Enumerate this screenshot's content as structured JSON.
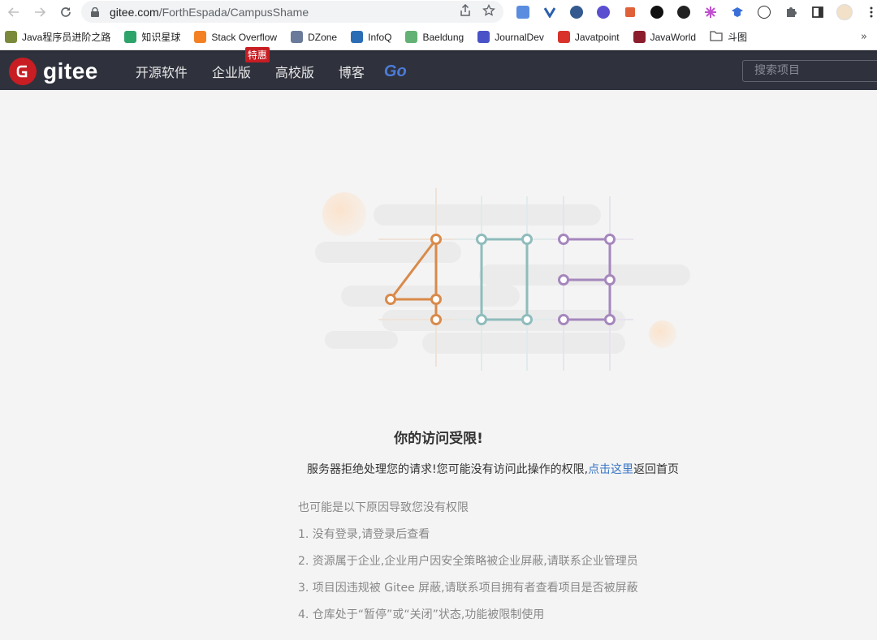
{
  "browser": {
    "url_domain": "gitee.com",
    "url_path": "/ForthEspada/CampusShame",
    "bookmarks": [
      {
        "label": "Java程序员进阶之路",
        "color": "#7a8a3a"
      },
      {
        "label": "知识星球",
        "color": "#2ea36a"
      },
      {
        "label": "Stack Overflow",
        "color": "#f48024"
      },
      {
        "label": "DZone",
        "color": "#6a7a9a"
      },
      {
        "label": "InfoQ",
        "color": "#2b6db5"
      },
      {
        "label": "Baeldung",
        "color": "#63b175"
      },
      {
        "label": "JournalDev",
        "color": "#4a52c8"
      },
      {
        "label": "Javatpoint",
        "color": "#d8322a"
      },
      {
        "label": "JavaWorld",
        "color": "#8b1d2c"
      },
      {
        "label": "斗图",
        "color": "#555555"
      }
    ],
    "more": "»"
  },
  "header": {
    "logo_text": "gitee",
    "nav": [
      {
        "label": "开源软件"
      },
      {
        "label": "企业版",
        "badge": "特惠"
      },
      {
        "label": "高校版"
      },
      {
        "label": "博客"
      }
    ],
    "go_label": "Go",
    "search_placeholder": "搜索项目"
  },
  "error": {
    "code": "403",
    "title": "你的访问受限!",
    "desc_before": "服务器拒绝处理您的请求!您可能没有访问此操作的权限,",
    "link_text": "点击这里",
    "desc_after": "返回首页",
    "reasons_title": "也可能是以下原因导致您没有权限",
    "reasons": [
      "1. 没有登录,请登录后查看",
      "2. 资源属于企业,企业用户因安全策略被企业屏蔽,请联系企业管理员",
      "3. 项目因违规被 Gitee 屏蔽,请联系项目拥有者查看项目是否被屏蔽",
      "4. 仓库处于“暂停”或“关闭”状态,功能被限制使用"
    ]
  },
  "colors": {
    "brand": "#c71d23",
    "digit4": "#d98a4a",
    "digit0": "#8fbcbc",
    "digit3": "#a587bd",
    "link": "#3875c6"
  }
}
